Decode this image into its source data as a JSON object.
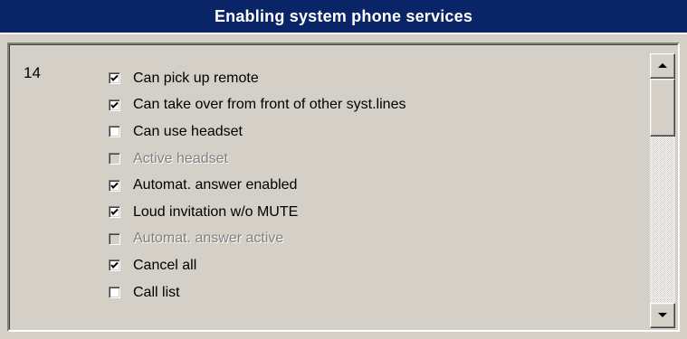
{
  "window": {
    "title": "Enabling system phone services",
    "title_bg": "#0a2468",
    "face": "#d4d0c8"
  },
  "panel": {
    "row_number": "14",
    "options": [
      {
        "label": "Can pick up remote",
        "checked": true,
        "enabled": true
      },
      {
        "label": "Can take over from front of other syst.lines",
        "checked": true,
        "enabled": true
      },
      {
        "label": "Can use headset",
        "checked": false,
        "enabled": true
      },
      {
        "label": "Active headset",
        "checked": false,
        "enabled": false
      },
      {
        "label": "Automat. answer enabled",
        "checked": true,
        "enabled": true
      },
      {
        "label": "Loud invitation w/o MUTE",
        "checked": true,
        "enabled": true
      },
      {
        "label": "Automat. answer active",
        "checked": false,
        "enabled": false
      },
      {
        "label": "Cancel all",
        "checked": true,
        "enabled": true
      },
      {
        "label": "Call list",
        "checked": false,
        "enabled": true
      }
    ]
  },
  "scrollbar": {
    "up_icon": "arrow-up-icon",
    "down_icon": "arrow-down-icon",
    "thumb_position": 0
  }
}
